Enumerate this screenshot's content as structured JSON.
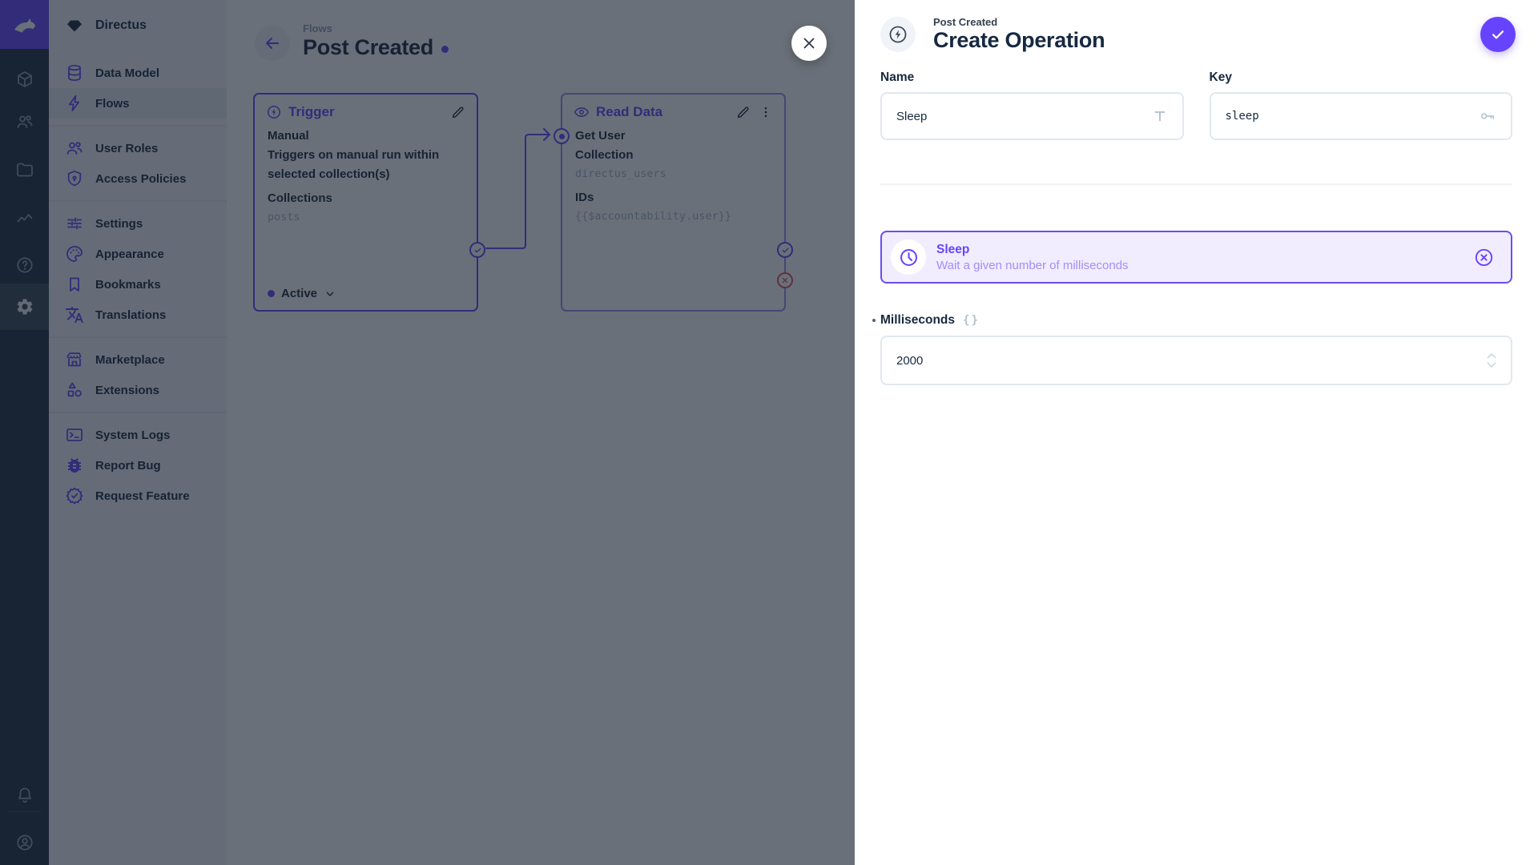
{
  "project": {
    "name": "Directus"
  },
  "nav": {
    "items": [
      {
        "label": "Data Model"
      },
      {
        "label": "Flows"
      },
      {
        "label": "User Roles"
      },
      {
        "label": "Access Policies"
      },
      {
        "label": "Settings"
      },
      {
        "label": "Appearance"
      },
      {
        "label": "Bookmarks"
      },
      {
        "label": "Translations"
      },
      {
        "label": "Marketplace"
      },
      {
        "label": "Extensions"
      },
      {
        "label": "System Logs"
      },
      {
        "label": "Report Bug"
      },
      {
        "label": "Request Feature"
      }
    ],
    "active_item": "Flows"
  },
  "flow": {
    "breadcrumb": "Flows",
    "title": "Post Created",
    "trigger": {
      "panel_title": "Trigger",
      "type": "Manual",
      "description_line1": "Triggers on manual run within",
      "description_line2": "selected collection(s)",
      "collections_label": "Collections",
      "collections_value": "posts",
      "status": "Active"
    },
    "read_data": {
      "panel_title": "Read Data",
      "name": "Get User",
      "collection_label": "Collection",
      "collection_value": "directus_users",
      "ids_label": "IDs",
      "ids_value": "{{$accountability.user}}"
    }
  },
  "drawer": {
    "breadcrumb": "Post Created",
    "title": "Create Operation",
    "fields": {
      "name": {
        "label": "Name",
        "value": "Sleep"
      },
      "key": {
        "label": "Key",
        "value": "sleep"
      },
      "milliseconds": {
        "label": "Milliseconds",
        "value": "2000"
      }
    },
    "operation": {
      "title": "Sleep",
      "description": "Wait a given number of milliseconds"
    }
  },
  "colors": {
    "primary": "#6644ff",
    "danger": "#e35169",
    "dark_text": "#172940",
    "subdued": "#a2b5cd"
  },
  "icons": {
    "braces": "{}",
    "names": [
      "directus-logo",
      "gem",
      "box-3d",
      "users",
      "folder",
      "insights",
      "help",
      "gear",
      "bell",
      "account",
      "database",
      "bolt",
      "people",
      "shield-lock",
      "tune",
      "palette",
      "bookmark",
      "translate",
      "storefront",
      "shapes",
      "terminal",
      "bug",
      "seal-check",
      "arrow-left",
      "pencil",
      "kebab",
      "eye",
      "bolt-circle",
      "check",
      "close-x",
      "clock",
      "key",
      "text-t",
      "circled-x",
      "chevron-down",
      "stepper-up",
      "stepper-down"
    ]
  }
}
